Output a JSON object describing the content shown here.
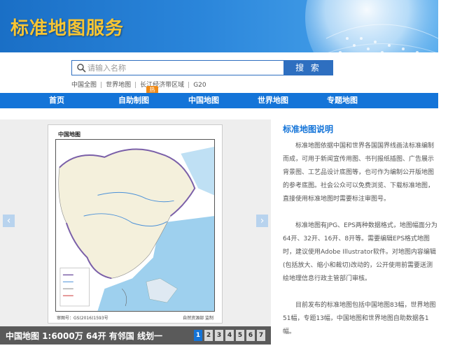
{
  "header": {
    "title": "标准地图服务"
  },
  "search": {
    "placeholder": "请输入名称",
    "button_label": "搜 索"
  },
  "quick_links": [
    "中国全图",
    "世界地图",
    "长江经济带区域",
    "G20"
  ],
  "nav": {
    "items": [
      "首页",
      "自助制图",
      "中国地图",
      "世界地图",
      "专题地图"
    ],
    "hot_badge": "热"
  },
  "slider": {
    "map_title": "中国地图",
    "map_footer_left": "审图号：GS(2016)1593号",
    "map_footer_right": "自然资源部 监制",
    "caption": "中国地图 1:6000万 64开 有邻国 线划一",
    "pages": [
      "1",
      "2",
      "3",
      "4",
      "5",
      "6",
      "7"
    ],
    "active_page": "1",
    "prev_arrow": "‹",
    "next_arrow": "›"
  },
  "info": {
    "title": "标准地图说明",
    "paragraphs": [
      "标准地图依据中国和世界各国国界线画法标准编制而成，可用于新闻宣传用图、书刊报纸插图、广告展示背景图、工艺品设计底图等，也可作为编制公开版地图的参考底图。社会公众可以免费浏览、下载标准地图，直接使用标准地图时需要标注审图号。",
      "标准地图有JPG、EPS两种数据格式，地图幅面分为64开、32开、16开、8开等。需要编辑EPS格式地图时，建议使用Adobe Illustrator软件。对地图内容编辑(包括放大、缩小和裁切)改动的，公开使用前需要送测绘地理信息行政主管部门审核。",
      "目前发布的标准地图包括中国地图83幅，世界地图51幅，专题13幅，中国地图和世界地图自助数据各1幅。"
    ]
  },
  "colors": {
    "brand_blue": "#1474d8",
    "title_gold": "#f7c534",
    "hot_orange": "#f08a16"
  }
}
